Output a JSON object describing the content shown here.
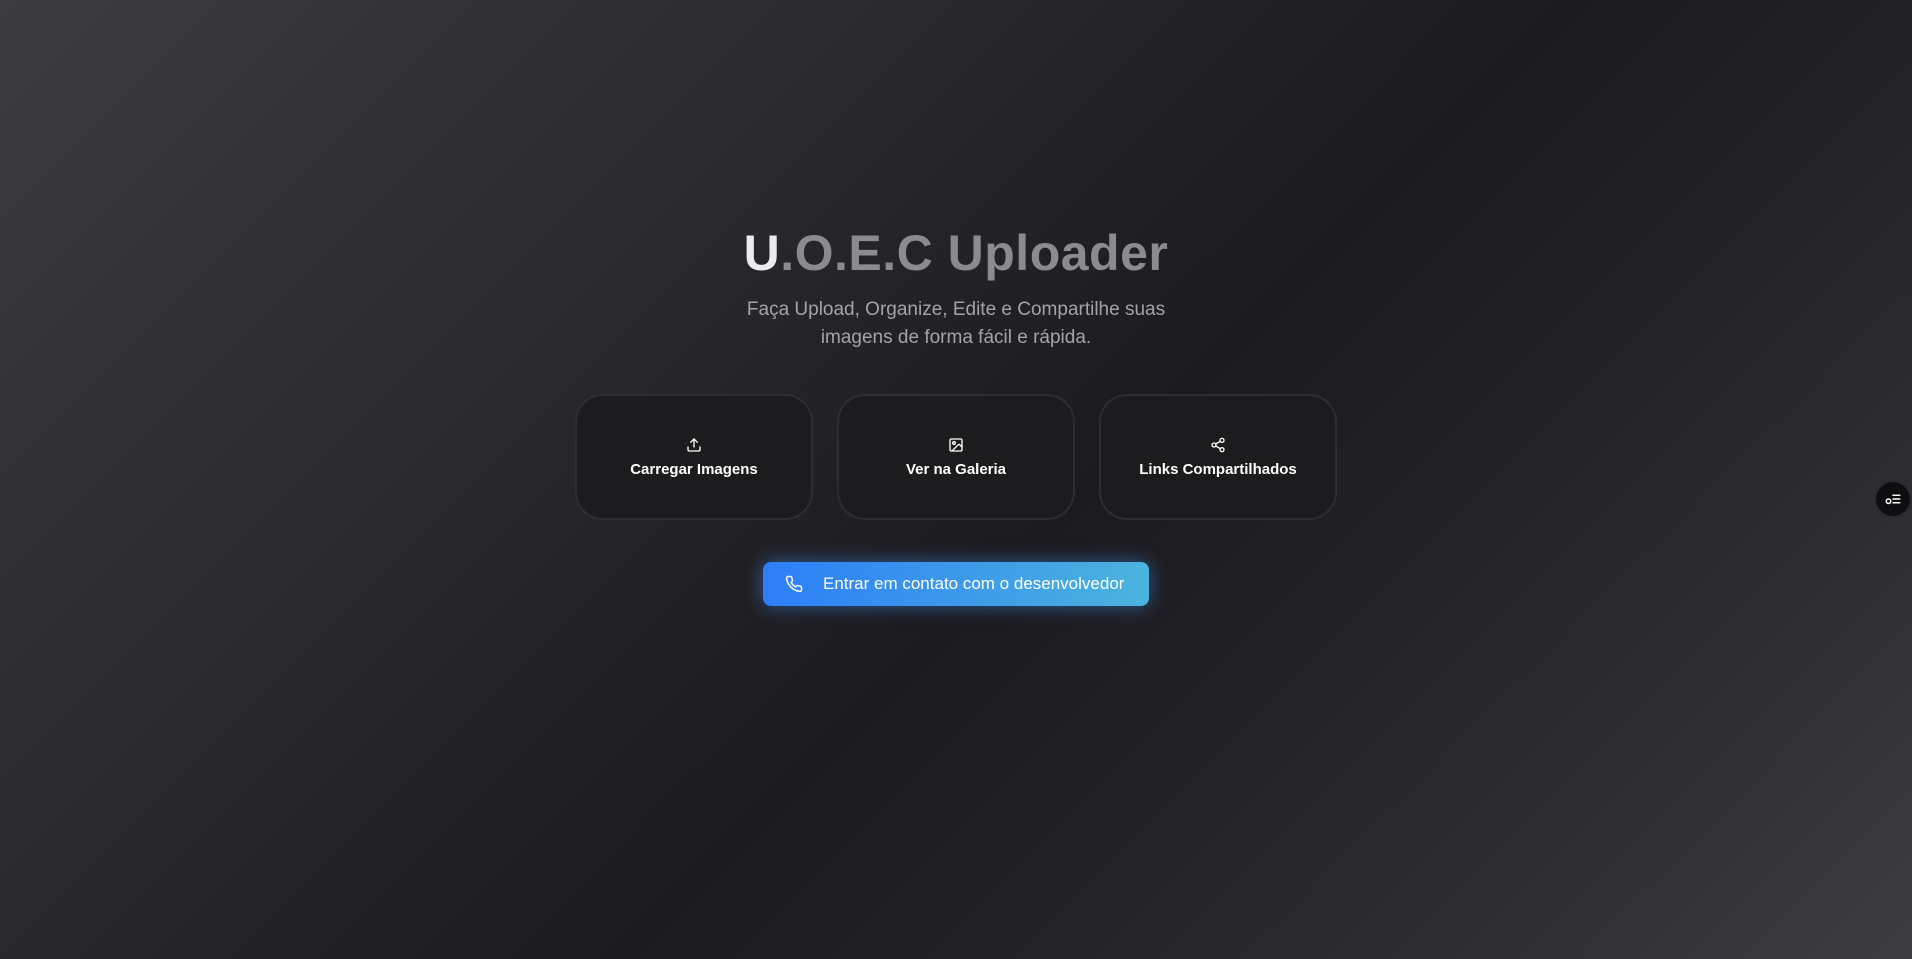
{
  "hero": {
    "title_first": "U",
    "title_rest": ".O.E.C Uploader",
    "subtitle": "Faça Upload, Organize, Edite e Compartilhe suas imagens de forma fácil e rápida."
  },
  "cards": [
    {
      "label": "Carregar Imagens",
      "icon": "upload-icon"
    },
    {
      "label": "Ver na Galeria",
      "icon": "image-icon"
    },
    {
      "label": "Links Compartilhados",
      "icon": "share-icon"
    }
  ],
  "contact_button": {
    "label": "Entrar em contato com o desenvolvedor",
    "icon": "phone-icon"
  },
  "floating_button": {
    "icon": "settings-list-icon"
  },
  "colors": {
    "accent_start": "#2d7ef7",
    "accent_end": "#4bb4dd",
    "card_bg": "#1c1c1e",
    "title_muted": "#8b8b8f"
  }
}
